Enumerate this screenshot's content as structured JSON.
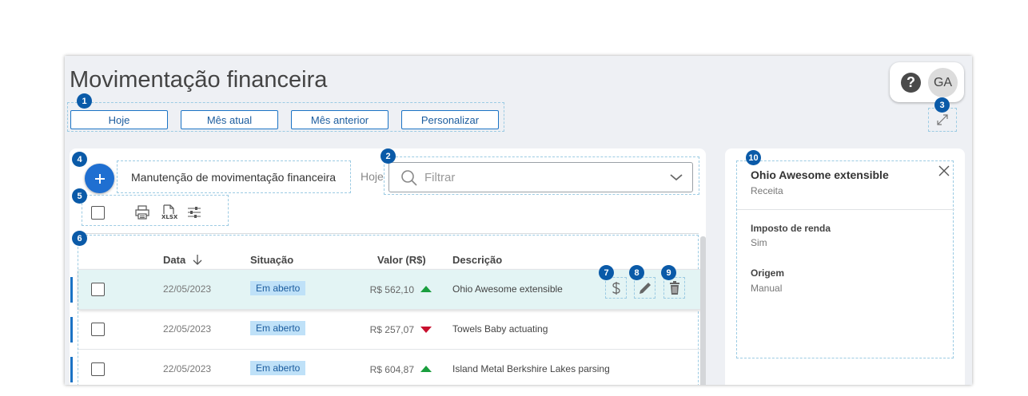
{
  "page": {
    "title": "Movimentação financeira"
  },
  "markers": [
    "1",
    "2",
    "3",
    "4",
    "5",
    "6",
    "7",
    "8",
    "9",
    "10"
  ],
  "periods": [
    "Hoje",
    "Mês atual",
    "Mês anterior",
    "Personalizar"
  ],
  "user": {
    "help": "?",
    "initials": "GA"
  },
  "maintenance": {
    "title": "Manutenção de movimentação financeira",
    "today_label": "Hoje"
  },
  "filter": {
    "placeholder": "Filtrar"
  },
  "toolbar": {
    "xlsx_label": "XLSX"
  },
  "table": {
    "columns": {
      "date": "Data",
      "status": "Situação",
      "value": "Valor (R$)",
      "description": "Descrição"
    },
    "rows": [
      {
        "date": "22/05/2023",
        "status": "Em aberto",
        "value": "R$ 562,10",
        "trend": "up",
        "description": "Ohio Awesome extensible"
      },
      {
        "date": "22/05/2023",
        "status": "Em aberto",
        "value": "R$ 257,07",
        "trend": "down",
        "description": "Towels Baby actuating"
      },
      {
        "date": "22/05/2023",
        "status": "Em aberto",
        "value": "R$ 604,87",
        "trend": "up",
        "description": "Island Metal Berkshire Lakes parsing"
      }
    ]
  },
  "detail": {
    "title": "Ohio Awesome extensible",
    "subtitle": "Receita",
    "fields": [
      {
        "label": "Imposto de renda",
        "value": "Sim"
      },
      {
        "label": "Origem",
        "value": "Manual"
      }
    ]
  },
  "colors": {
    "accent": "#1f6fd1",
    "selected_row": "#e3f4f4",
    "badge": "#bfe1f8",
    "marker": "#0a5aa8",
    "up": "#1a9e3e",
    "down": "#c8102e"
  }
}
